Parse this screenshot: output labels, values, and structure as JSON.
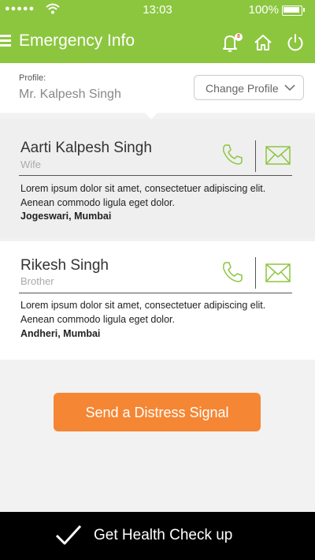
{
  "status_bar": {
    "signal": "●●●●●",
    "time": "13:03",
    "battery": "100%"
  },
  "header": {
    "title": "Emergency Info",
    "notification_count": "8"
  },
  "profile": {
    "label": "Profile:",
    "name": "Mr. Kalpesh Singh",
    "change_label": "Change Profile"
  },
  "contacts": [
    {
      "name": "Aarti Kalpesh Singh",
      "relation": "Wife",
      "description": "Lorem ipsum dolor sit amet, consectetuer adipiscing elit. Aenean commodo ligula eget dolor.",
      "location": "Jogeswari, Mumbai"
    },
    {
      "name": "Rikesh Singh",
      "relation": "Brother",
      "description": "Lorem ipsum dolor sit amet, consectetuer adipiscing elit. Aenean commodo ligula eget dolor.",
      "location": "Andheri, Mumbai"
    }
  ],
  "distress_label": "Send a Distress Signal",
  "bottom_bar": {
    "label": "Get Health Check up"
  },
  "colors": {
    "brand_green": "#8cc63f",
    "accent_orange": "#f58634",
    "bottom_bar": "#000000"
  },
  "icons": [
    "menu-icon",
    "bell-icon",
    "home-icon",
    "power-icon",
    "chevron-down-icon",
    "phone-icon",
    "mail-icon",
    "check-icon",
    "wifi-icon",
    "battery-icon"
  ]
}
